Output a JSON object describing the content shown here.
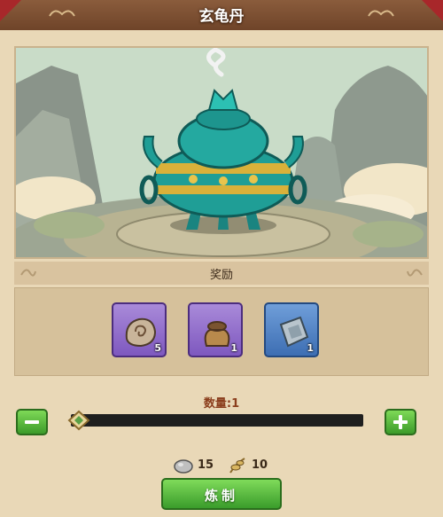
{
  "header": {
    "title": "玄龟丹"
  },
  "rewards_section": {
    "title": "奖励"
  },
  "rewards": [
    {
      "name": "stone-material",
      "count": "5",
      "rarity": "purple"
    },
    {
      "name": "pouch-material",
      "count": "1",
      "rarity": "purple"
    },
    {
      "name": "silver-ingot-material",
      "count": "1",
      "rarity": "blue"
    }
  ],
  "quantity": {
    "label": "数量:1",
    "value": 1
  },
  "cost": [
    {
      "icon": "stone-icon",
      "value": "15"
    },
    {
      "icon": "herb-icon",
      "value": "10"
    }
  ],
  "craft_button": {
    "label": "炼制"
  },
  "colors": {
    "accent_green": "#3c9b2a",
    "title_bar": "#6f4429",
    "cauldron": "#1f9e96"
  }
}
